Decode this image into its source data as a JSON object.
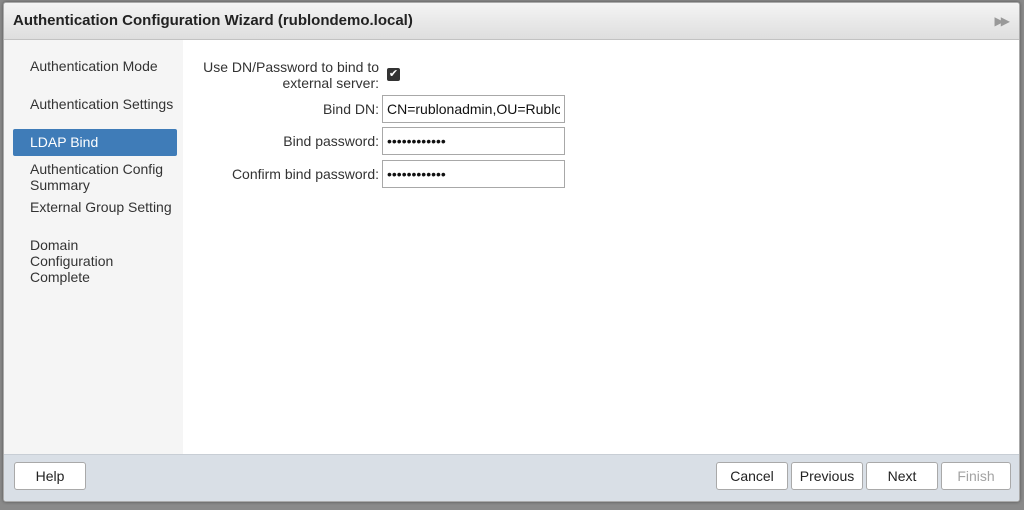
{
  "window": {
    "title": "Authentication Configuration Wizard (rublondemo.local)"
  },
  "sidebar": {
    "items": [
      {
        "label": "Authentication Mode"
      },
      {
        "label": "Authentication Settings"
      },
      {
        "label": "LDAP Bind",
        "active": true
      },
      {
        "label": "Authentication Config Summary"
      },
      {
        "label": "External Group Setting"
      },
      {
        "label": "Domain Configuration Complete"
      }
    ]
  },
  "form": {
    "use_dn_label": "Use DN/Password to bind to external server:",
    "use_dn_checked": true,
    "bind_dn_label": "Bind DN:",
    "bind_dn_value": "CN=rublonadmin,OU=Rublon",
    "bind_password_label": "Bind password:",
    "bind_password_value": "••••••••••••",
    "confirm_password_label": "Confirm bind password:",
    "confirm_password_value": "••••••••••••"
  },
  "footer": {
    "help_label": "Help",
    "cancel_label": "Cancel",
    "previous_label": "Previous",
    "next_label": "Next",
    "finish_label": "Finish"
  }
}
